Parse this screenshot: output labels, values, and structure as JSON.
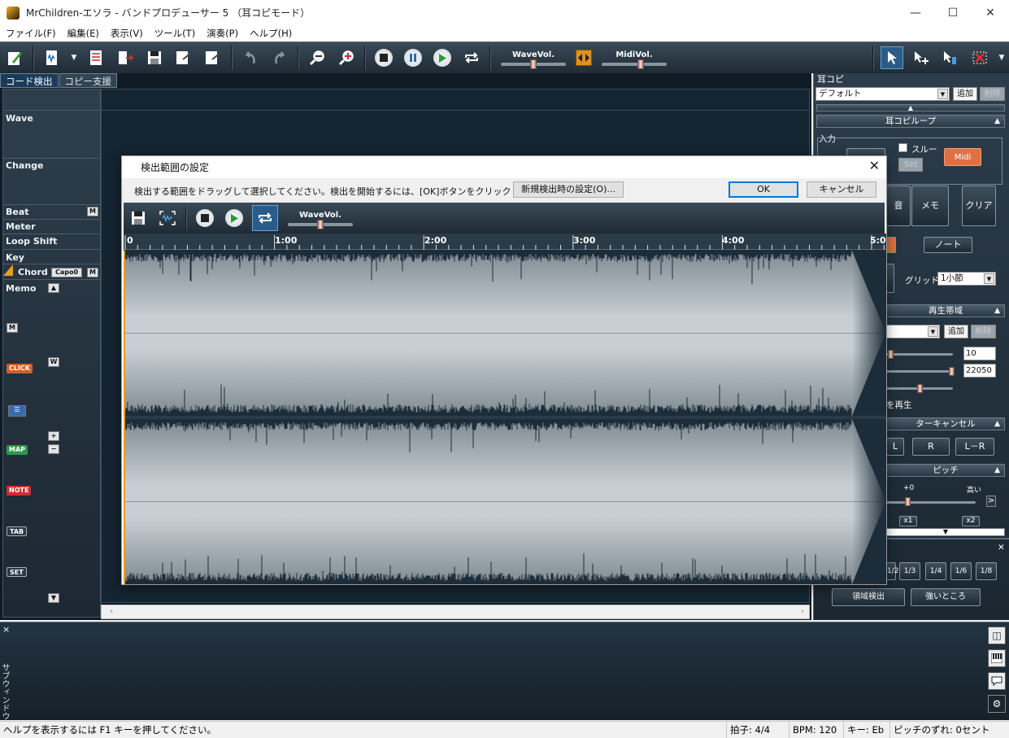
{
  "window": {
    "title": "MrChildren-エソラ - バンドプロデューサー 5 （耳コピモード）",
    "minimize": "—",
    "maximize": "☐",
    "close": "✕"
  },
  "menu": [
    "ファイル(F)",
    "編集(E)",
    "表示(V)",
    "ツール(T)",
    "演奏(P)",
    "ヘルプ(H)"
  ],
  "toolbar": {
    "wave_vol_label": "WaveVol.",
    "midi_vol_label": "MidiVol.",
    "wave_vol_level": 0.45,
    "midi_vol_level": 0.55
  },
  "tabs": [
    "コード検出",
    "コピー支援"
  ],
  "tracks": {
    "wave": "Wave",
    "change": "Change",
    "beat": "Beat",
    "meter": "Meter",
    "loop_shift": "Loop Shift",
    "key": "Key",
    "chord": "Chord",
    "capo": "Capo0",
    "memo": "Memo",
    "m_btn": "M",
    "w_btn": "W",
    "click": "CLICK",
    "map": "MAP",
    "note": "NOTE",
    "tab": "TAB",
    "set": "SET"
  },
  "right_panel": {
    "header": "耳コピ",
    "preset": "デフォルト",
    "add": "追加",
    "delete": "削除",
    "loop_section": "耳コピループ",
    "input_label": "入力",
    "thru_label": "スルー",
    "set_btn": "Set",
    "midi_btn": "Midi",
    "memo_btn": "メモ",
    "clear_btn": "クリア",
    "note_btn": "ノート",
    "grid_label": "グリッド",
    "grid_value": "1小節",
    "playband_section": "再生帯域",
    "band_low": "10",
    "band_high": "22050",
    "play_label": "を再生",
    "center_cancel_section": "ターキャンセル",
    "l_btn": "L",
    "r_btn": "R",
    "lr_btn": "L－R",
    "pitch_section": "ピッチ",
    "pitch_value": "+0",
    "pitch_high": "高い",
    "x1": "x1",
    "x2": "x2",
    "speeds": [
      "1/2",
      "1/3",
      "1/4",
      "1/6",
      "1/8"
    ],
    "region_detect": "領域検出",
    "strong_part": "強いところ"
  },
  "subwindow": {
    "label": "サブウィンドウ",
    "close": "×"
  },
  "status": {
    "help": "ヘルプを表示するには F1 キーを押してください。",
    "meter": "拍子: 4/4",
    "bpm": "BPM: 120",
    "key": "キー: Eb",
    "pitch_offset": "ピッチのずれ: 0セント"
  },
  "dialog": {
    "title": "検出範囲の設定",
    "instruction": "検出する範囲をドラッグして選択してください。検出を開始するには、[OK]ボタンをクリックします。",
    "settings_btn": "新規検出時の設定(O)...",
    "ok_btn": "OK",
    "cancel_btn": "キャンセル",
    "wave_vol_label": "WaveVol.",
    "wave_vol_level": 0.45,
    "ruler": [
      "0",
      "1:00",
      "2:00",
      "3:00",
      "4:00",
      "5:0"
    ]
  }
}
